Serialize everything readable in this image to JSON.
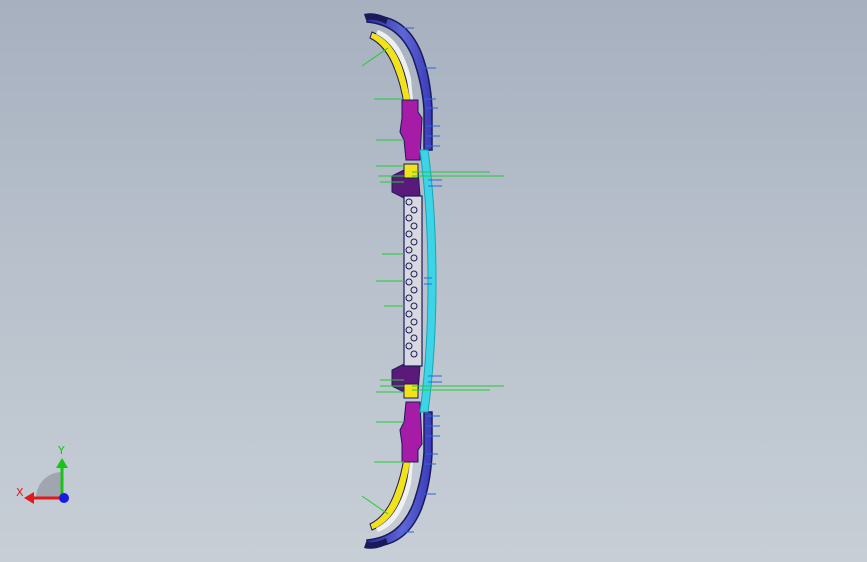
{
  "viewport": {
    "background_top": "#a6b0bf",
    "background_bottom": "#c7ced6"
  },
  "colors": {
    "outline": "#1a1a5a",
    "dark_blue_shell": "#2a2aa0",
    "light_blue_shell": "#6f7bdc",
    "yellow_part": "#f2e21a",
    "magenta_part": "#a61ca6",
    "purple_dark": "#5a1a7a",
    "cyan_part": "#3ed4e8",
    "teal_edge": "#1aa6b0",
    "green_leader": "#22cc33",
    "blue_leader": "#2a66e0",
    "white_part": "#f5f5f5"
  },
  "triad": {
    "x_label": "X",
    "y_label": "Y",
    "x_color": "#e01a1a",
    "y_color": "#1ac21a",
    "z_color": "#1a1ae0"
  }
}
